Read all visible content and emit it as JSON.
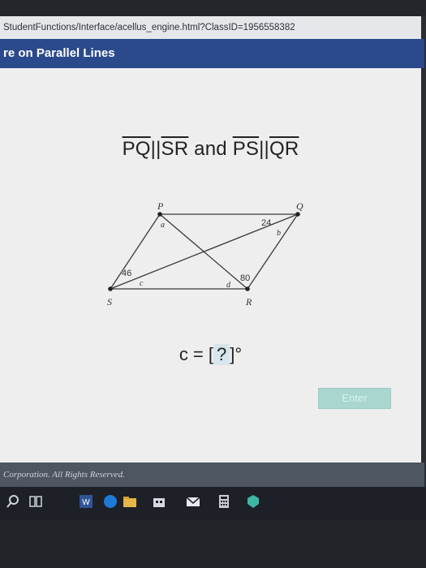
{
  "browser": {
    "url": "StudentFunctions/Interface/acellus_engine.html?ClassID=1956558382"
  },
  "app": {
    "title": "re on Parallel Lines"
  },
  "problem": {
    "heading_seg1": "PQ",
    "heading_sep1": "||",
    "heading_seg2": "SR",
    "heading_and": " and ",
    "heading_seg3": "PS",
    "heading_sep2": "||",
    "heading_seg4": "QR",
    "question_prefix": "c = [",
    "question_blank": " ? ",
    "question_suffix": "]°",
    "enter_label": "Enter"
  },
  "diagram": {
    "vertices": {
      "P": "P",
      "Q": "Q",
      "R": "R",
      "S": "S"
    },
    "angle_labels": {
      "a": "a",
      "b": "b",
      "c": "c",
      "d": "d"
    },
    "given_angles": {
      "q_angle": "24",
      "s_angle": "46",
      "r_angle": "80"
    }
  },
  "footer": {
    "copyright": "Corporation.  All Rights Reserved."
  },
  "taskbar": {
    "icons": [
      "search-icon",
      "task-view-icon",
      "word-icon",
      "edge-icon",
      "file-explorer-icon",
      "store-icon",
      "mail-icon",
      "calculator-icon",
      "security-icon"
    ]
  }
}
